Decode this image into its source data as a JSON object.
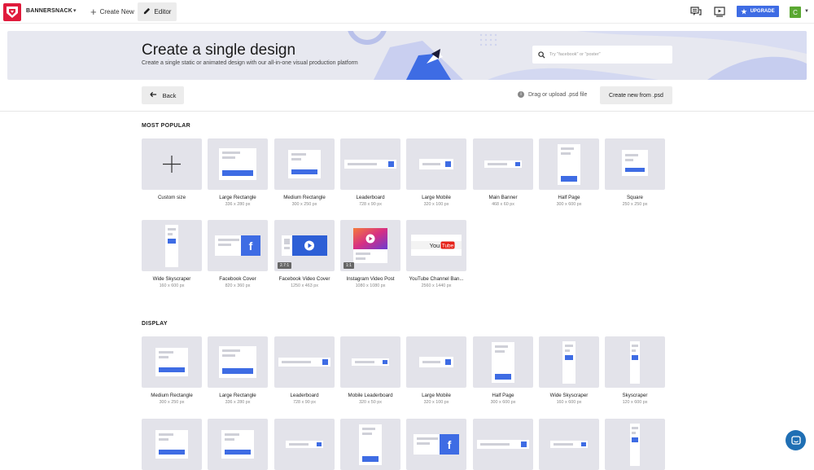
{
  "app": {
    "brand": "BANNERSNACK",
    "create_new": "Create New",
    "editor": "Editor",
    "upgrade": "UPGRADE",
    "avatar_initial": "C"
  },
  "hero": {
    "title": "Create a single design",
    "subtitle": "Create a single static or animated design with our all-in-one visual production platform",
    "search_placeholder": "Try \"facebook\" or \"poster\""
  },
  "actions": {
    "back": "Back",
    "drag_upload": "Drag or upload .psd file",
    "create_from_psd": "Create new from .psd"
  },
  "sections": {
    "popular_title": "MOST POPULAR",
    "display_title": "DISPLAY"
  },
  "popular": [
    {
      "name": "Custom size",
      "size": "",
      "icon": "plus-icon"
    },
    {
      "name": "Large Rectangle",
      "size": "336 x 280 px",
      "icon": "large-rectangle-icon"
    },
    {
      "name": "Medium Rectangle",
      "size": "300 x 250 px",
      "icon": "medium-rectangle-icon"
    },
    {
      "name": "Leaderboard",
      "size": "728 x 90 px",
      "icon": "leaderboard-icon"
    },
    {
      "name": "Large Mobile",
      "size": "320 x 100 px",
      "icon": "large-mobile-icon"
    },
    {
      "name": "Main Banner",
      "size": "468 x 60 px",
      "icon": "main-banner-icon"
    },
    {
      "name": "Half Page",
      "size": "300 x 600 px",
      "icon": "half-page-icon"
    },
    {
      "name": "Square",
      "size": "250 x 250 px",
      "icon": "square-icon"
    },
    {
      "name": "Wide Skyscraper",
      "size": "160 x 600 px",
      "icon": "wide-skyscraper-icon"
    },
    {
      "name": "Facebook Cover",
      "size": "820 x 360 px",
      "icon": "facebook-cover-icon"
    },
    {
      "name": "Facebook Video Cover",
      "size": "1250 x 463 px",
      "icon": "facebook-video-icon",
      "ratio": "2.7:1"
    },
    {
      "name": "Instagram Video Post",
      "size": "1080 x 1080 px",
      "icon": "instagram-video-icon",
      "ratio": "1:1"
    },
    {
      "name": "YouTube Channel Ban...",
      "size": "2560 x 1440 px",
      "icon": "youtube-icon",
      "brand_text": "YouTube"
    }
  ],
  "display": [
    {
      "name": "Medium Rectangle",
      "size": "300 x 250 px",
      "icon": "medium-rectangle-icon"
    },
    {
      "name": "Large Rectangle",
      "size": "336 x 280 px",
      "icon": "large-rectangle-icon"
    },
    {
      "name": "Leaderboard",
      "size": "728 x 90 px",
      "icon": "leaderboard-icon"
    },
    {
      "name": "Mobile Leaderboard",
      "size": "320 x 50 px",
      "icon": "mobile-leaderboard-icon"
    },
    {
      "name": "Large Mobile",
      "size": "320 x 100 px",
      "icon": "large-mobile-icon"
    },
    {
      "name": "Half Page",
      "size": "300 x 600 px",
      "icon": "half-page-icon"
    },
    {
      "name": "Wide Skyscraper",
      "size": "160 x 600 px",
      "icon": "wide-skyscraper-icon"
    },
    {
      "name": "Skyscraper",
      "size": "120 x 600 px",
      "icon": "skyscraper-icon"
    }
  ],
  "colors": {
    "accent": "#3e6ce4",
    "thumb_bg": "#e3e3ea",
    "brand_red": "#e01b3c",
    "avatar_green": "#5aa832"
  }
}
